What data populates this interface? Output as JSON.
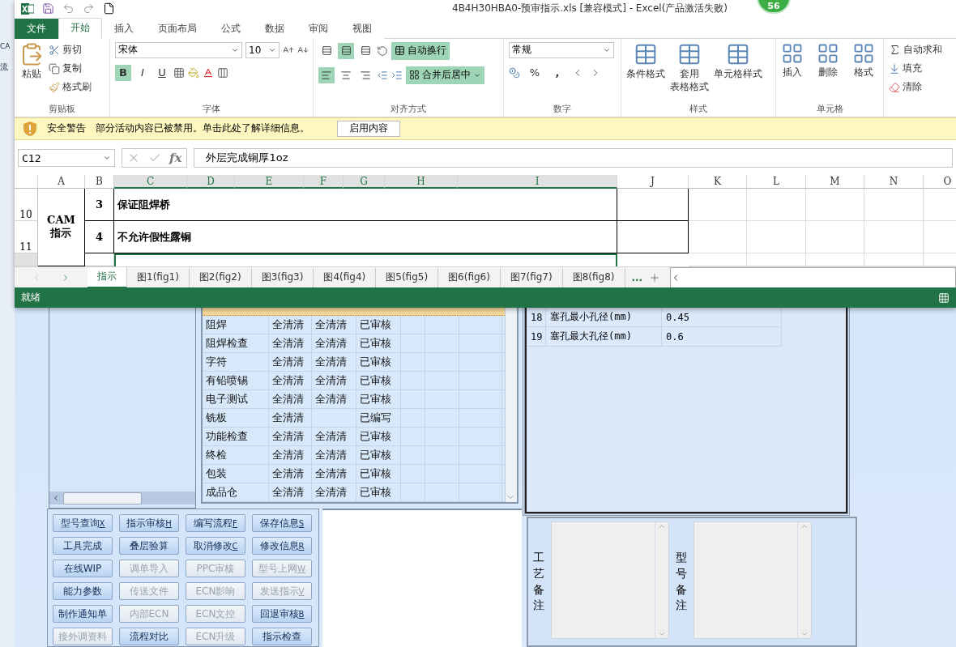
{
  "background_app": {
    "side_texts": [
      "CA",
      "流"
    ],
    "badge": "56",
    "process_grid": {
      "rows": [
        {
          "cells": [
            "阻焊",
            "全清清",
            "全清清",
            "已审核"
          ]
        },
        {
          "cells": [
            "阻焊检查",
            "全清清",
            "全清清",
            "已审核"
          ]
        },
        {
          "cells": [
            "字符",
            "全清清",
            "全清清",
            "已审核"
          ]
        },
        {
          "cells": [
            "有铅喷锡",
            "全清清",
            "全清清",
            "已审核"
          ]
        },
        {
          "cells": [
            "电子测试",
            "全清清",
            "全清清",
            "已审核"
          ]
        },
        {
          "cells": [
            "铣板",
            "全清清",
            "",
            "已编写"
          ]
        },
        {
          "cells": [
            "功能检查",
            "全清清",
            "全清清",
            "已审核"
          ]
        },
        {
          "cells": [
            "终检",
            "全清清",
            "全清清",
            "已审核"
          ]
        },
        {
          "cells": [
            "包装",
            "全清清",
            "全清清",
            "已审核"
          ]
        },
        {
          "cells": [
            "成品仓",
            "全清清",
            "全清清",
            "已审核"
          ]
        }
      ]
    },
    "param_table": {
      "rows": [
        {
          "no": "18",
          "name": "塞孔最小孔径(mm)",
          "value": "0.45"
        },
        {
          "no": "19",
          "name": "塞孔最大孔径(mm)",
          "value": "0.6"
        }
      ]
    },
    "buttons": [
      {
        "label": "型号查询",
        "key": "X",
        "disabled": false
      },
      {
        "label": "指示审核",
        "key": "H",
        "disabled": false
      },
      {
        "label": "编写流程",
        "key": "F",
        "disabled": false
      },
      {
        "label": "保存信息",
        "key": "S",
        "disabled": false
      },
      {
        "label": "工具完成",
        "disabled": false
      },
      {
        "label": "叠层验算",
        "disabled": false
      },
      {
        "label": "取消修改",
        "key": "C",
        "disabled": false
      },
      {
        "label": "修改信息",
        "key": "R",
        "disabled": false
      },
      {
        "label": "在线WIP",
        "disabled": false
      },
      {
        "label": "调单导入",
        "disabled": true
      },
      {
        "label": "PPC审核",
        "disabled": true
      },
      {
        "label": "型号上网",
        "key": "W",
        "disabled": true
      },
      {
        "label": "能力参数",
        "disabled": false
      },
      {
        "label": "传送文件",
        "disabled": true
      },
      {
        "label": "ECN影响",
        "disabled": true
      },
      {
        "label": "发送指示",
        "key": "V",
        "disabled": true
      },
      {
        "label": "制作通知单",
        "disabled": false
      },
      {
        "label": "内部ECN",
        "disabled": true
      },
      {
        "label": "ECN文控",
        "disabled": true
      },
      {
        "label": "回退审核",
        "key": "B",
        "disabled": false
      },
      {
        "label": "接外调资料",
        "disabled": true
      },
      {
        "label": "流程对比",
        "disabled": false
      },
      {
        "label": "ECN升级",
        "disabled": true
      },
      {
        "label": "指示检查",
        "disabled": false
      }
    ],
    "notes": [
      {
        "label": "工艺备注"
      },
      {
        "label": "型号备注"
      }
    ]
  },
  "excel": {
    "title": "4B4H30HBA0-预审指示.xls  [兼容模式] - Excel(产品激活失败)",
    "tabs": [
      {
        "label": "文件",
        "kind": "file",
        "selected": false
      },
      {
        "label": "开始",
        "selected": true
      },
      {
        "label": "插入",
        "selected": false
      },
      {
        "label": "页面布局",
        "selected": false
      },
      {
        "label": "公式",
        "selected": false
      },
      {
        "label": "数据",
        "selected": false
      },
      {
        "label": "审阅",
        "selected": false
      },
      {
        "label": "视图",
        "selected": false
      }
    ],
    "clipboard": {
      "paste": "粘贴",
      "cut": "剪切",
      "copy": "复制",
      "painter": "格式刷",
      "group": "剪贴板"
    },
    "font": {
      "name": "宋体",
      "size": "10",
      "styles": [
        {
          "label": "B",
          "on": true
        },
        {
          "label": "I",
          "on": false
        },
        {
          "label": "U",
          "on": false
        }
      ],
      "group": "字体"
    },
    "alignment": {
      "vertical_buttons": [
        {
          "selected": false
        },
        {
          "selected": true
        },
        {
          "selected": false
        }
      ],
      "horizontal_buttons": [
        {
          "selected": true
        },
        {
          "selected": false
        },
        {
          "selected": false
        }
      ],
      "wrap": {
        "label": "自动换行",
        "on": true
      },
      "merge": {
        "label": "合并后居中",
        "on": true
      },
      "group": "对齐方式"
    },
    "number": {
      "format": "常规",
      "percent": "%",
      "comma": ",",
      "group": "数字"
    },
    "styles": {
      "items": [
        {
          "lines": [
            "条件格式"
          ]
        },
        {
          "lines": [
            "套用",
            "表格格式"
          ]
        },
        {
          "lines": [
            "单元格样式"
          ]
        }
      ],
      "group": "样式"
    },
    "cells": {
      "items": [
        "插入",
        "删除",
        "格式"
      ],
      "group": "单元格"
    },
    "editing": {
      "items": [
        "自动求和",
        "填充",
        "清除"
      ]
    },
    "warning": {
      "title": "安全警告",
      "message": "部分活动内容已被禁用。单击此处了解详细信息。",
      "button": "启用内容"
    },
    "formula_bar": {
      "name_box": "C12",
      "fx": "fx",
      "value": "外层完成铜厚1oz"
    },
    "sheet": {
      "columns": [
        {
          "label": "A",
          "selected": false
        },
        {
          "label": "B",
          "selected": false
        },
        {
          "label": "C",
          "selected": true
        },
        {
          "label": "D",
          "selected": true
        },
        {
          "label": "E",
          "selected": true
        },
        {
          "label": "F",
          "selected": true
        },
        {
          "label": "G",
          "selected": true
        },
        {
          "label": "H",
          "selected": true
        },
        {
          "label": "I",
          "selected": true
        },
        {
          "label": "J",
          "selected": false
        },
        {
          "label": "K",
          "selected": false
        },
        {
          "label": "L",
          "selected": false
        },
        {
          "label": "M",
          "selected": false
        },
        {
          "label": "N",
          "selected": false
        },
        {
          "label": "O",
          "selected": false
        }
      ],
      "rows": [
        {
          "header": "10",
          "selected": false,
          "no": "3",
          "text": "保证阻焊桥"
        },
        {
          "header": "11",
          "selected": false,
          "no": "4",
          "text": "不允许假性露铜"
        },
        {
          "header": "",
          "selected": true
        }
      ],
      "merged_label": [
        "CAM",
        "指示"
      ]
    },
    "sheet_tabs": [
      {
        "label": "指示",
        "selected": true
      },
      {
        "label": "图1(fig1)",
        "selected": false
      },
      {
        "label": "图2(fig2)",
        "selected": false
      },
      {
        "label": "图3(fig3)",
        "selected": false
      },
      {
        "label": "图4(fig4)",
        "selected": false
      },
      {
        "label": "图5(fig5)",
        "selected": false
      },
      {
        "label": "图6(fig6)",
        "selected": false
      },
      {
        "label": "图7(fig7)",
        "selected": false
      },
      {
        "label": "图8(fig8)",
        "selected": false
      }
    ],
    "more_tabs": "...",
    "status": "就绪"
  }
}
